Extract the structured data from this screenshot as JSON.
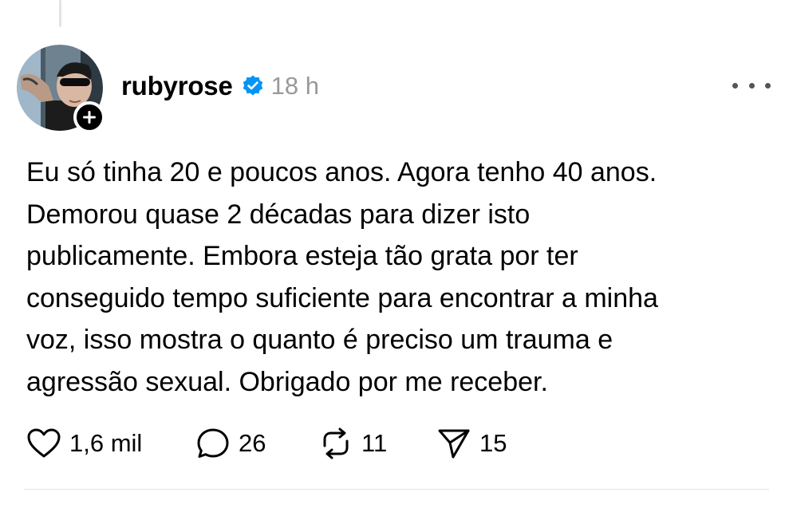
{
  "post": {
    "author": {
      "username": "rubyrose",
      "verified": true,
      "avatar": "profile-photo",
      "follow_icon": "plus-icon"
    },
    "timestamp": "18 h",
    "more_icon": "more-horizontal-icon",
    "text_lines": [
      "Eu só tinha 20 e poucos anos. Agora tenho 40 anos.",
      "Demorou quase 2 décadas para dizer isto",
      "publicamente. Embora esteja tão grata por ter",
      "conseguido tempo suficiente para encontrar a minha",
      "voz, isso mostra o quanto é preciso um trauma e",
      "agressão sexual. Obrigado por me receber."
    ],
    "actions": {
      "likes": {
        "icon": "heart-icon",
        "count": "1,6 mil"
      },
      "replies": {
        "icon": "comment-icon",
        "count": "26"
      },
      "reposts": {
        "icon": "repost-icon",
        "count": "11"
      },
      "shares": {
        "icon": "send-icon",
        "count": "15"
      }
    }
  },
  "colors": {
    "verified_badge": "#0095f6",
    "secondary_text": "#999999",
    "divider": "#e4e4e4"
  }
}
